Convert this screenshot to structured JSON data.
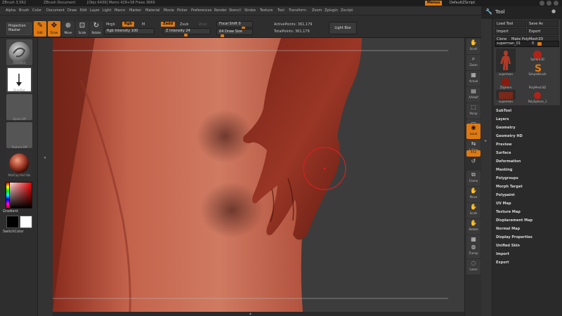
{
  "titlebar": {
    "app": "ZBrush 3.5R2",
    "document": "ZBrush Document",
    "stats": "[Objs 6439]  Mems 428+58  Frees 3669",
    "menus_button": "Menus",
    "script": "DefaultZScript"
  },
  "menubar": {
    "items": [
      "Alpha",
      "Brush",
      "Color",
      "Document",
      "Draw",
      "Edit",
      "Layer",
      "Light",
      "Macro",
      "Marker",
      "Material",
      "Movie",
      "Picker",
      "Preferences",
      "Render",
      "Stencil",
      "Stroke",
      "Texture",
      "Tool",
      "Transform",
      "Zoom",
      "Zplugin",
      "Zscript"
    ]
  },
  "toolbar": {
    "projection_master": "Projection Master",
    "edit": "Edit",
    "draw": "Draw",
    "move": "Move",
    "scale": "Scale",
    "rotate": "Rotate",
    "mrgb": "Mrgb",
    "rgb": "Rgb",
    "m": "M",
    "rgb_intensity": "Rgb Intensity 100",
    "zadd": "Zadd",
    "zsub": "Zsub",
    "zcut": "Zcut",
    "z_intensity": "Z Intensity 24",
    "focal_shift": "Focal Shift 0",
    "draw_size": "64 Draw Size",
    "active_points": "ActivePoints: 361,179",
    "total_points": "TotalPoints: 361,179",
    "light_box": "Light Box"
  },
  "leftshelf": {
    "brush_caption": "Standard",
    "stroke_caption": "DragDot",
    "alpha_caption": "Alpha Off",
    "texture_caption": "Texture Off",
    "material_caption": "MatCap Red Wa",
    "gradient": "Gradient",
    "switch_color": "SwitchColor"
  },
  "rightshelf": {
    "buttons": [
      {
        "label": "Scroll",
        "icon": "hand-icon"
      },
      {
        "label": "Zoom",
        "icon": "magnifier-icon"
      },
      {
        "label": "Actual",
        "icon": "actual-icon"
      },
      {
        "label": "AAHalf",
        "icon": "aahalf-icon"
      },
      {
        "label": "Persp",
        "icon": "persp-icon"
      },
      {
        "label": "Floor",
        "icon": "floor-icon"
      },
      {
        "label": "Local",
        "icon": "local-icon"
      },
      {
        "label": "L.Sym",
        "icon": "lsym-icon"
      },
      {
        "label": "XYZ",
        "icon": "xyz-icon"
      },
      {
        "label": "Frame",
        "icon": "frame-icon"
      },
      {
        "label": "Move",
        "icon": "move-icon"
      },
      {
        "label": "Scale",
        "icon": "scale-icon"
      },
      {
        "label": "Rotate",
        "icon": "rotate-icon"
      },
      {
        "label": "PolyF",
        "icon": "polyf-icon"
      },
      {
        "label": "Transp",
        "icon": "transp-icon"
      },
      {
        "label": "Lasso",
        "icon": "lasso-icon"
      }
    ]
  },
  "toolpanel": {
    "title": "Tool",
    "load_tool": "Load Tool",
    "save_as": "Save As",
    "import": "Import",
    "export": "Export",
    "clone": "Clone",
    "make_polymesh": "Make PolyMesh3D",
    "current_tool": "superman_01",
    "current_tool_value": "0",
    "tools": [
      {
        "name": "superman"
      },
      {
        "name": "Sphere3D"
      },
      {
        "name": "SimpleBrush"
      },
      {
        "name": "ZSphere"
      },
      {
        "name": "PolyMesh3D"
      },
      {
        "name": "superman"
      },
      {
        "name": "PolySphere_1"
      }
    ],
    "sections": [
      "SubTool",
      "Layers",
      "Geometry",
      "Geometry HD",
      "Preview",
      "Surface",
      "Deformation",
      "Masking",
      "Polygroups",
      "Morph Target",
      "Polypaint",
      "UV Map",
      "Texture Map",
      "Displacement Map",
      "Normal Map",
      "Display Properties",
      "Unified Skin",
      "Import",
      "Export"
    ]
  },
  "colors": {
    "accent": "#e07a10",
    "skin": "#b4503c",
    "background": "#3c3c3c"
  }
}
